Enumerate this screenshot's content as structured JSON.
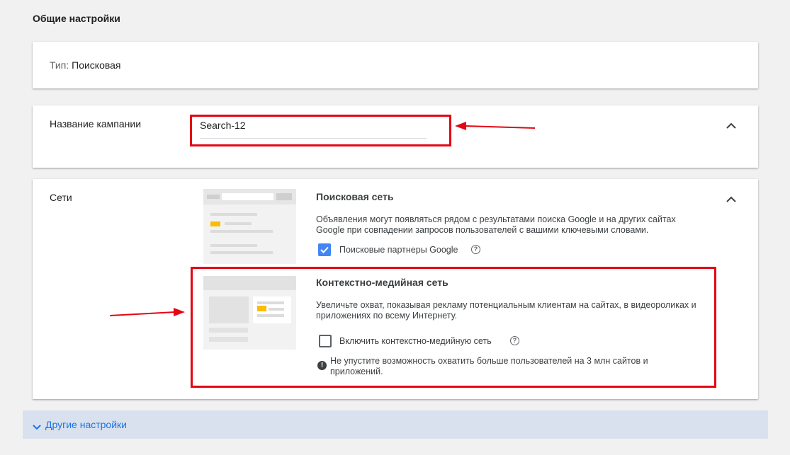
{
  "general": {
    "title": "Общие настройки"
  },
  "type_card": {
    "label": "Тип:",
    "value": "Поисковая"
  },
  "name_card": {
    "label": "Название кампании",
    "value": "Search-12"
  },
  "networks": {
    "label": "Сети",
    "search": {
      "title": "Поисковая сеть",
      "description": "Объявления могут появляться рядом с результатами поиска Google и на других сайтах Google при совпадении запросов пользователей с вашими ключевыми словами.",
      "partners_label": "Поисковые партнеры Google",
      "partners_checked": true
    },
    "display": {
      "title": "Контекстно-медийная сеть",
      "description": "Увеличьте охват, показывая рекламу потенциальным клиентам на сайтах, в видеороликах и приложениях по всему Интернету.",
      "include_label": "Включить контекстно-медийную сеть",
      "include_checked": false,
      "notice": "Не упустите возможность охватить больше пользователей на 3 млн сайтов и приложений."
    }
  },
  "other": {
    "label": "Другие настройки"
  },
  "colors": {
    "annotation_red": "#e30613",
    "checkbox_blue": "#4285f4",
    "link_blue": "#1a73e8",
    "bar_bg": "#d9e1ee"
  }
}
